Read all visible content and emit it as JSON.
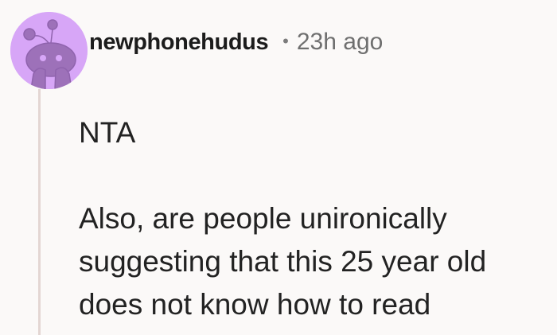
{
  "comment": {
    "username": "newphonehudus",
    "separator": "•",
    "timestamp": "23h ago",
    "verdict": "NTA",
    "body_lines": [
      "Also, are people unironically",
      "suggesting that this 25 year old",
      "does not know how to read"
    ]
  },
  "colors": {
    "avatar_bg": "#d7a6f7",
    "avatar_snoo": "#9d71b9",
    "thread_line": "#e3d6d3",
    "page_bg": "#fbf9f8"
  },
  "icons": {
    "avatar": "snoo-avatar-icon"
  }
}
